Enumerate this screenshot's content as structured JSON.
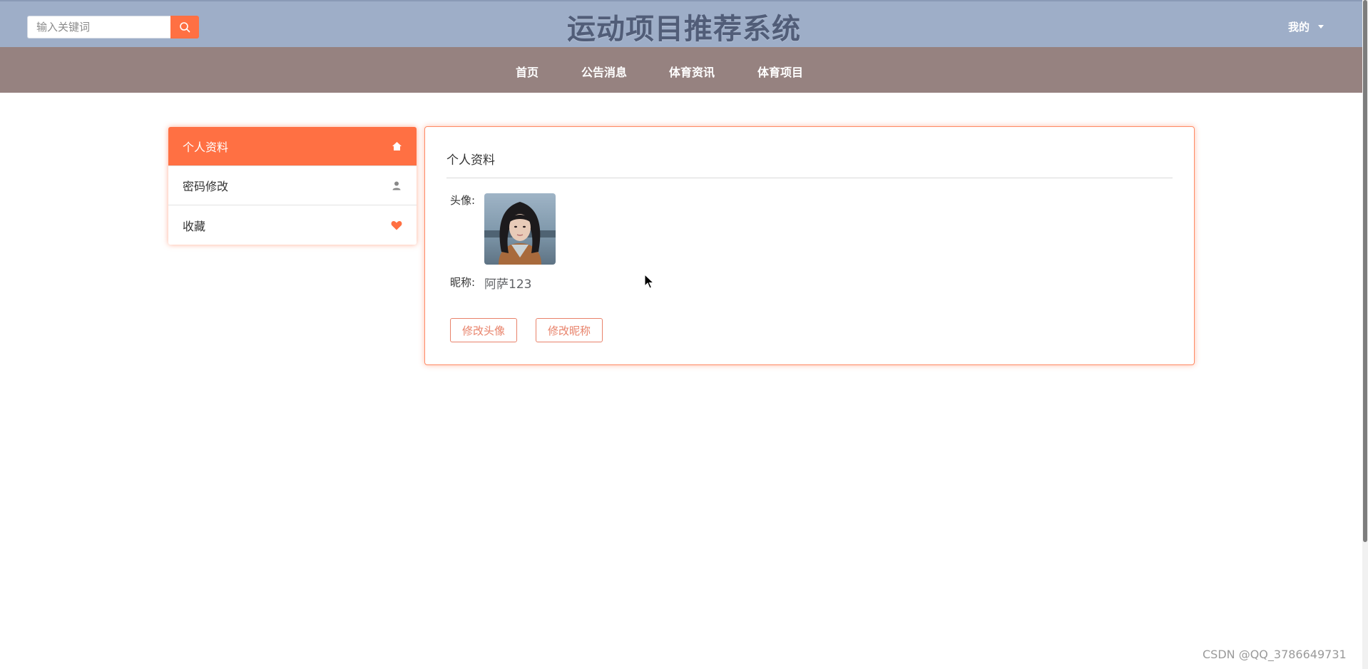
{
  "header": {
    "search_placeholder": "输入关键词",
    "title": "运动项目推荐系统",
    "user_menu_label": "我的"
  },
  "nav": {
    "items": [
      {
        "label": "首页"
      },
      {
        "label": "公告消息"
      },
      {
        "label": "体育资讯"
      },
      {
        "label": "体育项目"
      }
    ]
  },
  "sidebar": {
    "items": [
      {
        "label": "个人资料",
        "icon": "home-icon",
        "active": true
      },
      {
        "label": "密码修改",
        "icon": "user-icon",
        "active": false
      },
      {
        "label": "收藏",
        "icon": "heart-icon",
        "active": false
      }
    ]
  },
  "profile": {
    "card_title": "个人资料",
    "avatar_label": "头像:",
    "nickname_label": "昵称:",
    "nickname_value": "阿萨123",
    "change_avatar_button": "修改头像",
    "change_nickname_button": "修改昵称"
  },
  "watermark": "CSDN @QQ_3786649731",
  "colors": {
    "header_bg": "#9eaec8",
    "nav_bg": "#968280",
    "accent": "#ff7043",
    "title_color": "#515d78"
  }
}
